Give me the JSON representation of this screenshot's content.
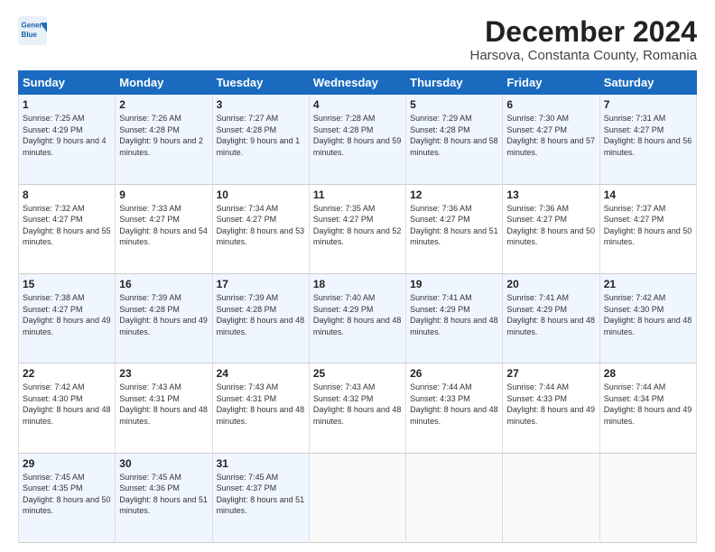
{
  "logo": {
    "line1": "General",
    "line2": "Blue"
  },
  "title": "December 2024",
  "subtitle": "Harsova, Constanta County, Romania",
  "weekdays": [
    "Sunday",
    "Monday",
    "Tuesday",
    "Wednesday",
    "Thursday",
    "Friday",
    "Saturday"
  ],
  "weeks": [
    [
      {
        "day": "1",
        "sunrise": "Sunrise: 7:25 AM",
        "sunset": "Sunset: 4:29 PM",
        "daylight": "Daylight: 9 hours and 4 minutes."
      },
      {
        "day": "2",
        "sunrise": "Sunrise: 7:26 AM",
        "sunset": "Sunset: 4:28 PM",
        "daylight": "Daylight: 9 hours and 2 minutes."
      },
      {
        "day": "3",
        "sunrise": "Sunrise: 7:27 AM",
        "sunset": "Sunset: 4:28 PM",
        "daylight": "Daylight: 9 hours and 1 minute."
      },
      {
        "day": "4",
        "sunrise": "Sunrise: 7:28 AM",
        "sunset": "Sunset: 4:28 PM",
        "daylight": "Daylight: 8 hours and 59 minutes."
      },
      {
        "day": "5",
        "sunrise": "Sunrise: 7:29 AM",
        "sunset": "Sunset: 4:28 PM",
        "daylight": "Daylight: 8 hours and 58 minutes."
      },
      {
        "day": "6",
        "sunrise": "Sunrise: 7:30 AM",
        "sunset": "Sunset: 4:27 PM",
        "daylight": "Daylight: 8 hours and 57 minutes."
      },
      {
        "day": "7",
        "sunrise": "Sunrise: 7:31 AM",
        "sunset": "Sunset: 4:27 PM",
        "daylight": "Daylight: 8 hours and 56 minutes."
      }
    ],
    [
      {
        "day": "8",
        "sunrise": "Sunrise: 7:32 AM",
        "sunset": "Sunset: 4:27 PM",
        "daylight": "Daylight: 8 hours and 55 minutes."
      },
      {
        "day": "9",
        "sunrise": "Sunrise: 7:33 AM",
        "sunset": "Sunset: 4:27 PM",
        "daylight": "Daylight: 8 hours and 54 minutes."
      },
      {
        "day": "10",
        "sunrise": "Sunrise: 7:34 AM",
        "sunset": "Sunset: 4:27 PM",
        "daylight": "Daylight: 8 hours and 53 minutes."
      },
      {
        "day": "11",
        "sunrise": "Sunrise: 7:35 AM",
        "sunset": "Sunset: 4:27 PM",
        "daylight": "Daylight: 8 hours and 52 minutes."
      },
      {
        "day": "12",
        "sunrise": "Sunrise: 7:36 AM",
        "sunset": "Sunset: 4:27 PM",
        "daylight": "Daylight: 8 hours and 51 minutes."
      },
      {
        "day": "13",
        "sunrise": "Sunrise: 7:36 AM",
        "sunset": "Sunset: 4:27 PM",
        "daylight": "Daylight: 8 hours and 50 minutes."
      },
      {
        "day": "14",
        "sunrise": "Sunrise: 7:37 AM",
        "sunset": "Sunset: 4:27 PM",
        "daylight": "Daylight: 8 hours and 50 minutes."
      }
    ],
    [
      {
        "day": "15",
        "sunrise": "Sunrise: 7:38 AM",
        "sunset": "Sunset: 4:27 PM",
        "daylight": "Daylight: 8 hours and 49 minutes."
      },
      {
        "day": "16",
        "sunrise": "Sunrise: 7:39 AM",
        "sunset": "Sunset: 4:28 PM",
        "daylight": "Daylight: 8 hours and 49 minutes."
      },
      {
        "day": "17",
        "sunrise": "Sunrise: 7:39 AM",
        "sunset": "Sunset: 4:28 PM",
        "daylight": "Daylight: 8 hours and 48 minutes."
      },
      {
        "day": "18",
        "sunrise": "Sunrise: 7:40 AM",
        "sunset": "Sunset: 4:29 PM",
        "daylight": "Daylight: 8 hours and 48 minutes."
      },
      {
        "day": "19",
        "sunrise": "Sunrise: 7:41 AM",
        "sunset": "Sunset: 4:29 PM",
        "daylight": "Daylight: 8 hours and 48 minutes."
      },
      {
        "day": "20",
        "sunrise": "Sunrise: 7:41 AM",
        "sunset": "Sunset: 4:29 PM",
        "daylight": "Daylight: 8 hours and 48 minutes."
      },
      {
        "day": "21",
        "sunrise": "Sunrise: 7:42 AM",
        "sunset": "Sunset: 4:30 PM",
        "daylight": "Daylight: 8 hours and 48 minutes."
      }
    ],
    [
      {
        "day": "22",
        "sunrise": "Sunrise: 7:42 AM",
        "sunset": "Sunset: 4:30 PM",
        "daylight": "Daylight: 8 hours and 48 minutes."
      },
      {
        "day": "23",
        "sunrise": "Sunrise: 7:43 AM",
        "sunset": "Sunset: 4:31 PM",
        "daylight": "Daylight: 8 hours and 48 minutes."
      },
      {
        "day": "24",
        "sunrise": "Sunrise: 7:43 AM",
        "sunset": "Sunset: 4:31 PM",
        "daylight": "Daylight: 8 hours and 48 minutes."
      },
      {
        "day": "25",
        "sunrise": "Sunrise: 7:43 AM",
        "sunset": "Sunset: 4:32 PM",
        "daylight": "Daylight: 8 hours and 48 minutes."
      },
      {
        "day": "26",
        "sunrise": "Sunrise: 7:44 AM",
        "sunset": "Sunset: 4:33 PM",
        "daylight": "Daylight: 8 hours and 48 minutes."
      },
      {
        "day": "27",
        "sunrise": "Sunrise: 7:44 AM",
        "sunset": "Sunset: 4:33 PM",
        "daylight": "Daylight: 8 hours and 49 minutes."
      },
      {
        "day": "28",
        "sunrise": "Sunrise: 7:44 AM",
        "sunset": "Sunset: 4:34 PM",
        "daylight": "Daylight: 8 hours and 49 minutes."
      }
    ],
    [
      {
        "day": "29",
        "sunrise": "Sunrise: 7:45 AM",
        "sunset": "Sunset: 4:35 PM",
        "daylight": "Daylight: 8 hours and 50 minutes."
      },
      {
        "day": "30",
        "sunrise": "Sunrise: 7:45 AM",
        "sunset": "Sunset: 4:36 PM",
        "daylight": "Daylight: 8 hours and 51 minutes."
      },
      {
        "day": "31",
        "sunrise": "Sunrise: 7:45 AM",
        "sunset": "Sunset: 4:37 PM",
        "daylight": "Daylight: 8 hours and 51 minutes."
      },
      null,
      null,
      null,
      null
    ]
  ]
}
